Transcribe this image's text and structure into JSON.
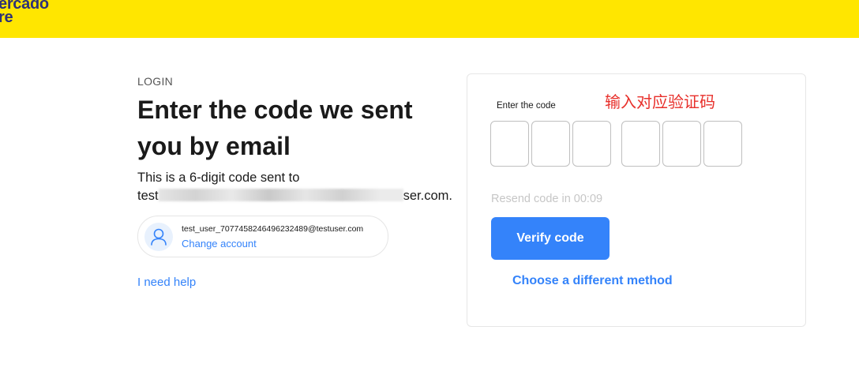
{
  "header": {
    "logo_line1": "ercado",
    "logo_line2": "re"
  },
  "login": {
    "eyebrow": "LOGIN",
    "title": "Enter the code we sent you by email",
    "subtitle_line1": "This is a 6-digit code sent to",
    "subtitle_email_prefix": "test",
    "subtitle_email_suffix": "ser.com.",
    "account_email": "test_user_7077458246496232489@testuser.com",
    "change_account": "Change account",
    "help_link": "I need help"
  },
  "code_card": {
    "label": "Enter the code",
    "annotation": "输入对应验证码",
    "digits": [
      "",
      "",
      "",
      "",
      "",
      ""
    ],
    "resend_text": "Resend code in 00:09",
    "verify_button": "Verify code",
    "different_method": "Choose a different method"
  },
  "colors": {
    "brand_yellow": "#ffe600",
    "accent_blue": "#3483fa",
    "annotation_red": "#e8302b"
  }
}
